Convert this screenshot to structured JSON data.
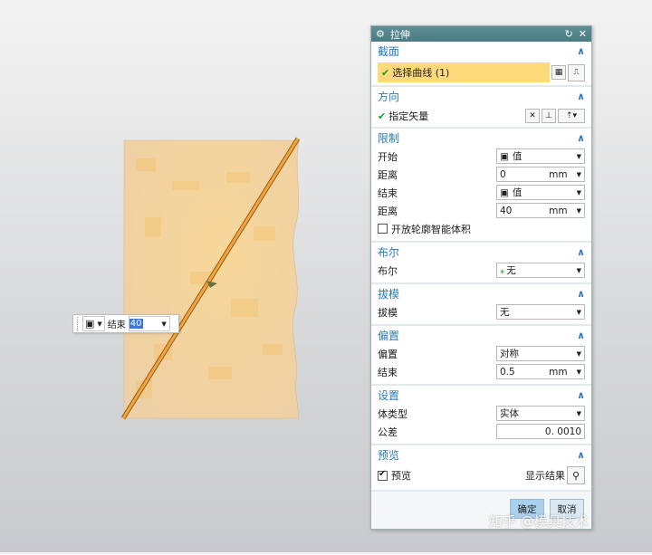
{
  "floating_input": {
    "label": "结束",
    "value": "40"
  },
  "dialog": {
    "title": "拉伸",
    "sections": {
      "section": {
        "title": "截面",
        "select_curve": "选择曲线 (1)"
      },
      "direction": {
        "title": "方向",
        "specify_vector": "指定矢量"
      },
      "limits": {
        "title": "限制",
        "start_label": "开始",
        "start_value": "值",
        "distance1_label": "距离",
        "distance1_value": "0",
        "distance1_unit": "mm",
        "end_label": "结束",
        "end_value": "值",
        "distance2_label": "距离",
        "distance2_value": "40",
        "distance2_unit": "mm",
        "open_profile_label": "开放轮廓智能体积"
      },
      "boolean": {
        "title": "布尔",
        "label": "布尔",
        "value": "无"
      },
      "draft": {
        "title": "拔模",
        "label": "拔模",
        "value": "无"
      },
      "offset": {
        "title": "偏置",
        "offset_label": "偏置",
        "offset_value": "对称",
        "end_label": "结束",
        "end_value": "0.5",
        "end_unit": "mm"
      },
      "settings": {
        "title": "设置",
        "body_type_label": "体类型",
        "body_type_value": "实体",
        "tolerance_label": "公差",
        "tolerance_value": "0. 0010"
      },
      "preview": {
        "title": "预览",
        "preview_label": "预览",
        "show_result_label": "显示结果"
      }
    },
    "buttons": {
      "ok": "确定",
      "cancel": "取消"
    }
  },
  "watermark": "知乎 @模具技术",
  "colors": {
    "titlebar": "#4f8088",
    "section_title": "#2a7bb8",
    "highlight": "#ffd97a",
    "check": "#1c9a2a"
  }
}
